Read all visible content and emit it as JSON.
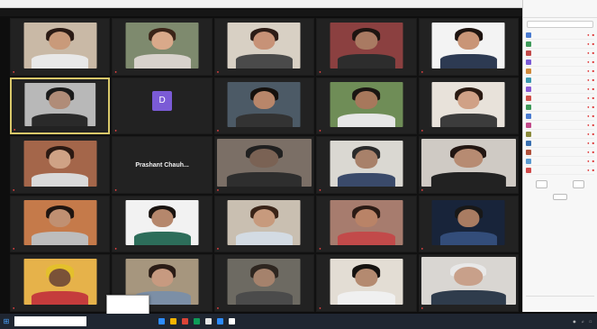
{
  "meeting": {
    "tiles": [
      {
        "skin": "#c99a7a",
        "hair": "#2a1a14",
        "shirt": "#e8e8e8",
        "bg": "#c9b9a6"
      },
      {
        "skin": "#d9a98a",
        "hair": "#3b2418",
        "shirt": "#d8d2cc",
        "bg": "#7e8a6e"
      },
      {
        "skin": "#c79277",
        "hair": "#2c1c16",
        "shirt": "#4a4a4a",
        "bg": "#d8d0c4"
      },
      {
        "skin": "#a97a62",
        "hair": "#1d1410",
        "shirt": "#2d2d2d",
        "bg": "#8b4040"
      },
      {
        "skin": "#c99577",
        "hair": "#1e1410",
        "shirt": "#2d3a52",
        "bg": "#f3f3f3"
      },
      {
        "skin": "#b08c78",
        "hair": "#1a1a1a",
        "shirt": "#2a2a2a",
        "bg": "#b8b8b8"
      },
      {
        "avatar": "D",
        "avatar_color": "#7b5bd6"
      },
      {
        "skin": "#b8866a",
        "hair": "#15100c",
        "shirt": "#333",
        "bg": "#4c5a66"
      },
      {
        "skin": "#a7785c",
        "hair": "#1a1512",
        "shirt": "#e6e6e6",
        "bg": "#6f8d57"
      },
      {
        "skin": "#d0a186",
        "hair": "#2a1a12",
        "shirt": "#3c3c3c",
        "bg": "#e8e2da"
      },
      {
        "skin": "#cfa285",
        "hair": "#2b1912",
        "shirt": "#d9d9d9",
        "bg": "#a4664a"
      },
      {
        "center": "Prashant Chauh..."
      },
      {
        "skin": "#7a6254",
        "hair": "#202020",
        "shirt": "#2e2e2e",
        "bg": "#7b6f66"
      },
      {
        "skin": "#a8816a",
        "hair": "#2a2a2a",
        "shirt": "#3a4a6a",
        "bg": "#dad8d2"
      },
      {
        "skin": "#b78b72",
        "hair": "#221612",
        "shirt": "#222",
        "bg": "#cfcac4"
      },
      {
        "skin": "#c09072",
        "hair": "#1f1510",
        "shirt": "#bdbdbd",
        "bg": "#c57a4a"
      },
      {
        "skin": "#b5876c",
        "hair": "#1a1410",
        "shirt": "#2d6d5a",
        "bg": "#f2f2f2"
      },
      {
        "skin": "#c79a7d",
        "hair": "#3a2418",
        "shirt": "#d3dbe3",
        "bg": "#c9bfb1"
      },
      {
        "skin": "#b98367",
        "hair": "#2a1a14",
        "shirt": "#c24a4a",
        "bg": "#a77c6e"
      },
      {
        "skin": "#a97c62",
        "hair": "#181818",
        "shirt": "#334d7a",
        "bg": "#18243a"
      },
      {
        "skin": "#7a5238",
        "hair": "#e4c02c",
        "shirt": "#c53c3c",
        "bg": "#e6b24a"
      },
      {
        "skin": "#c79a80",
        "hair": "#2a1c16",
        "shirt": "#7c8fa6",
        "bg": "#a6967e"
      },
      {
        "skin": "#a5826c",
        "hair": "#2e2620",
        "shirt": "#4b4b4b",
        "bg": "#6d6a62"
      },
      {
        "skin": "#b48a70",
        "hair": "#151210",
        "shirt": "#f0f0f0",
        "bg": "#e3ddd4"
      },
      {
        "skin": "#c8a08a",
        "hair": "#e8e8e8",
        "shirt": "#2f3c4c",
        "bg": "#d9d6d2"
      }
    ],
    "center_name": "Prashant Chauh...",
    "avatar_letter": "D"
  },
  "panel": {
    "avatar_colors": [
      "#4a7bd0",
      "#3f9a5a",
      "#c24a4a",
      "#7b5bd6",
      "#d08a3c",
      "#3a9ab0",
      "#8a5bd6",
      "#d0504a",
      "#3f9a5a",
      "#4a7bd0",
      "#c24a8a",
      "#8a8a3c",
      "#3a70b0",
      "#b0503a",
      "#5a9ad0",
      "#d04a4a"
    ]
  },
  "taskbar": {
    "app_colors": [
      "#2d8cff",
      "#f4b400",
      "#db4437",
      "#0f9d58",
      "#e6e6e6",
      "#2d8cff",
      "#ffffff"
    ]
  }
}
